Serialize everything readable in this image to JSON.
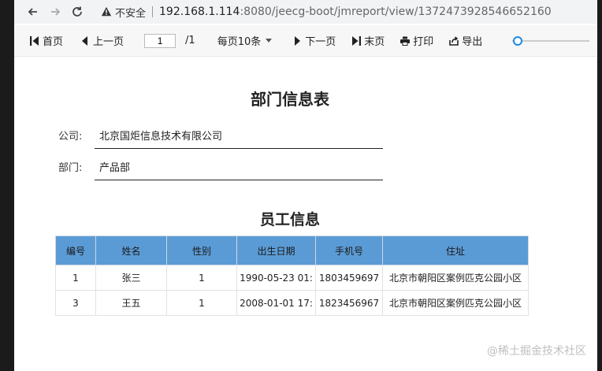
{
  "browser": {
    "security_label": "不安全",
    "url_host": "192.168.1.114",
    "url_rest": ":8080/jeecg-boot/jmreport/view/1372473928546652160"
  },
  "toolbar": {
    "first": "首页",
    "prev": "上一页",
    "page_current": "1",
    "page_total": "/1",
    "per_page": "每页10条",
    "next": "下一页",
    "last": "末页",
    "print": "打印",
    "export": "导出"
  },
  "report": {
    "title": "部门信息表",
    "company_label": "公司:",
    "company_value": "北京国炬信息技术有限公司",
    "dept_label": "部门:",
    "dept_value": "产品部",
    "section_title": "员工信息",
    "columns": [
      "编号",
      "姓名",
      "性别",
      "出生日期",
      "手机号",
      "住址"
    ],
    "rows": [
      [
        "1",
        "张三",
        "1",
        "1990-05-23 01:",
        "1803459697",
        "北京市朝阳区案例匹克公园小区"
      ],
      [
        "3",
        "王五",
        "1",
        "2008-01-01 17:",
        "1823456967",
        "北京市朝阳区案例匹克公园小区"
      ]
    ]
  },
  "watermark": "@稀土掘金技术社区",
  "colors": {
    "header_bg": "#5b9bd5",
    "accent": "#1e88e5"
  }
}
